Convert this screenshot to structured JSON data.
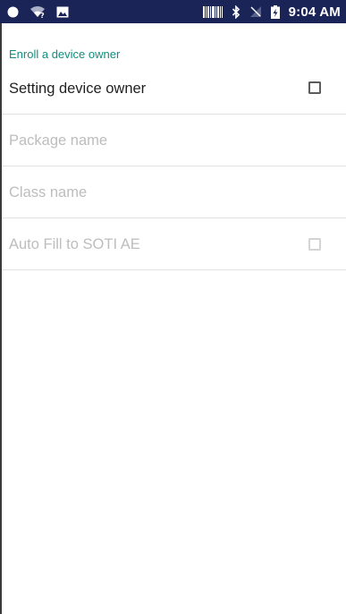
{
  "status_bar": {
    "time": "9:04 AM",
    "icons": [
      "circle-notification-icon",
      "wifi-question-icon",
      "image-icon",
      "barcode-icon",
      "bluetooth-icon",
      "no-sim-icon",
      "battery-charging-icon"
    ]
  },
  "colors": {
    "status_bar_bg": "#1b2456",
    "accent": "#138d7e",
    "disabled_text": "#bdbdbd",
    "divider": "#e2e2e2"
  },
  "settings": {
    "section_header": "Enroll a device owner",
    "items": [
      {
        "label": "Setting device owner",
        "type": "checkbox",
        "checked": false,
        "enabled": true
      },
      {
        "label": "Package name",
        "type": "text",
        "enabled": false
      },
      {
        "label": "Class name",
        "type": "text",
        "enabled": false
      },
      {
        "label": "Auto Fill to SOTI AE",
        "type": "checkbox",
        "checked": false,
        "enabled": false
      }
    ]
  }
}
